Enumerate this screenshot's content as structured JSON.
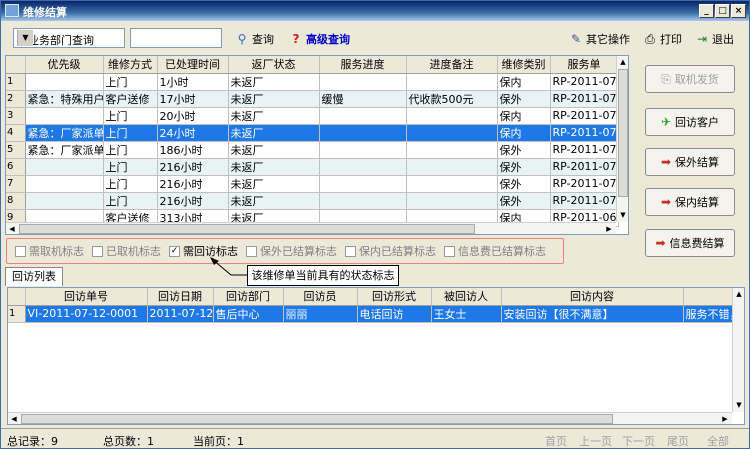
{
  "window": {
    "title": "维修结算",
    "colors": {
      "titlebar": "#0a246a",
      "selection": "#1e78e8",
      "highlight_border": "#f08080"
    }
  },
  "toolbar": {
    "query_mode": "按业务部门查询",
    "search_value": "",
    "query_label": "查询",
    "advanced_label": "高级查询",
    "other_ops_label": "其它操作",
    "print_label": "打印",
    "exit_label": "退出"
  },
  "repair_table": {
    "headers": [
      "优先级",
      "维修方式",
      "已处理时间",
      "返厂状态",
      "服务进度",
      "进度备注",
      "维修类别",
      "服务单"
    ],
    "rows": [
      {
        "num": "1",
        "cells": [
          "",
          "上门",
          "1小时",
          "未返厂",
          "",
          "",
          "保内",
          "RP-2011-07-"
        ]
      },
      {
        "num": "2",
        "cells": [
          "紧急：特殊用户",
          "客户送修",
          "17小时",
          "未返厂",
          "缓慢",
          "代收款500元",
          "保外",
          "RP-2011-07-"
        ]
      },
      {
        "num": "3",
        "cells": [
          "",
          "上门",
          "20小时",
          "未返厂",
          "",
          "",
          "保内",
          "RP-2011-07-"
        ]
      },
      {
        "num": "4",
        "cells": [
          "紧急：厂家派单",
          "上门",
          "24小时",
          "未返厂",
          "",
          "",
          "保内",
          "RP-2011-07-"
        ]
      },
      {
        "num": "5",
        "cells": [
          "紧急：厂家派单",
          "上门",
          "186小时",
          "未返厂",
          "",
          "",
          "保外",
          "RP-2011-07-"
        ]
      },
      {
        "num": "6",
        "cells": [
          "",
          "上门",
          "216小时",
          "未返厂",
          "",
          "",
          "保外",
          "RP-2011-07-"
        ]
      },
      {
        "num": "7",
        "cells": [
          "",
          "上门",
          "216小时",
          "未返厂",
          "",
          "",
          "保外",
          "RP-2011-07-"
        ]
      },
      {
        "num": "8",
        "cells": [
          "",
          "上门",
          "216小时",
          "未返厂",
          "",
          "",
          "保外",
          "RP-2011-07-"
        ]
      },
      {
        "num": "9",
        "cells": [
          "",
          "客户送修",
          "313小时",
          "未返厂",
          "",
          "",
          "保内",
          "RP-2011-06-"
        ]
      }
    ]
  },
  "side_buttons": [
    {
      "label": "取机发货",
      "icon": "device-icon",
      "enabled": false
    },
    {
      "label": "回访客户",
      "icon": "runner-icon",
      "enabled": true
    },
    {
      "label": "保外结算",
      "icon": "arrow-icon",
      "enabled": true
    },
    {
      "label": "保内结算",
      "icon": "arrow-icon",
      "enabled": true
    },
    {
      "label": "信息费结算",
      "icon": "arrow-icon",
      "enabled": true
    }
  ],
  "status_flags": [
    {
      "label": "需取机标志",
      "checked": false
    },
    {
      "label": "已取机标志",
      "checked": false
    },
    {
      "label": "需回访标志",
      "checked": true
    },
    {
      "label": "保外已结算标志",
      "checked": false
    },
    {
      "label": "保内已结算标志",
      "checked": false
    },
    {
      "label": "信息费已结算标志",
      "checked": false
    }
  ],
  "callout": "该维修单当前具有的状态标志",
  "visit_tab": "回访列表",
  "visit_table": {
    "headers": [
      "回访单号",
      "回访日期",
      "回访部门",
      "回访员",
      "回访形式",
      "被回访人",
      "回访内容",
      ""
    ],
    "rows": [
      {
        "num": "1",
        "cells": [
          "VI-2011-07-12-0001",
          "2011-07-12",
          "售后中心",
          "丽丽",
          "电话回访",
          "王女士",
          "安装回访【很不满意】",
          "服务不错，不"
        ]
      }
    ]
  },
  "status": {
    "total_records": "总记录：9",
    "total_pages": "总页数：1",
    "current_page": "当前页：1",
    "nav": [
      "首页",
      "上一页",
      "下一页",
      "尾页",
      "全部"
    ]
  }
}
